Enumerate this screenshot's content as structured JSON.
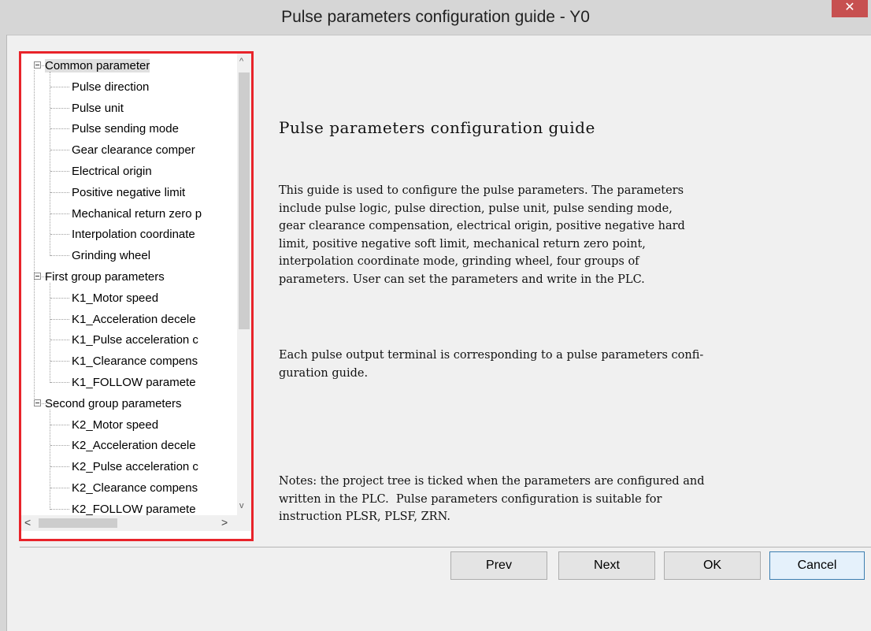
{
  "window": {
    "title": "Pulse parameters configuration guide - Y0",
    "close_glyph": "✕"
  },
  "tree": {
    "items": [
      {
        "label": "Common parameter",
        "level": 0
      },
      {
        "label": "Pulse direction",
        "level": 1
      },
      {
        "label": "Pulse unit",
        "level": 1
      },
      {
        "label": "Pulse sending mode",
        "level": 1
      },
      {
        "label": "Gear clearance comper",
        "level": 1
      },
      {
        "label": "Electrical origin",
        "level": 1
      },
      {
        "label": "Positive negative limit",
        "level": 1
      },
      {
        "label": "Mechanical return zero p",
        "level": 1
      },
      {
        "label": "Interpolation coordinate",
        "level": 1
      },
      {
        "label": "Grinding wheel",
        "level": 1
      },
      {
        "label": "First group parameters",
        "level": 0
      },
      {
        "label": "K1_Motor speed",
        "level": 1
      },
      {
        "label": "K1_Acceleration decele",
        "level": 1
      },
      {
        "label": "K1_Pulse acceleration c",
        "level": 1
      },
      {
        "label": "K1_Clearance compens",
        "level": 1
      },
      {
        "label": "K1_FOLLOW paramete",
        "level": 1
      },
      {
        "label": "Second group parameters",
        "level": 0
      },
      {
        "label": "K2_Motor speed",
        "level": 1
      },
      {
        "label": "K2_Acceleration decele",
        "level": 1
      },
      {
        "label": "K2_Pulse acceleration c",
        "level": 1
      },
      {
        "label": "K2_Clearance compens",
        "level": 1
      },
      {
        "label": "K2_FOLLOW paramete",
        "level": 1
      }
    ],
    "scroll": {
      "up": "^",
      "down": "v",
      "left": "<",
      "right": ">"
    }
  },
  "description": {
    "title": "Pulse parameters configuration guide",
    "para1": "This guide is used to configure the pulse parameters. The parameters\ninclude pulse logic, pulse direction, pulse unit, pulse sending mode,\ngear clearance compensation, electrical origin, positive negative hard\nlimit, positive negative soft limit, mechanical return zero point,\ninterpolation coordinate mode, grinding wheel, four groups of\nparameters. User can set the parameters and write in the PLC.",
    "para2": "Each pulse output terminal is corresponding to a pulse parameters confi-\nguration guide.",
    "para3": "Notes: the project tree is ticked when the parameters are configured and\nwritten in the PLC.  Pulse parameters configuration is suitable for\ninstruction PLSR, PLSF, ZRN."
  },
  "buttons": {
    "prev": "Prev",
    "next": "Next",
    "ok": "OK",
    "cancel": "Cancel"
  }
}
